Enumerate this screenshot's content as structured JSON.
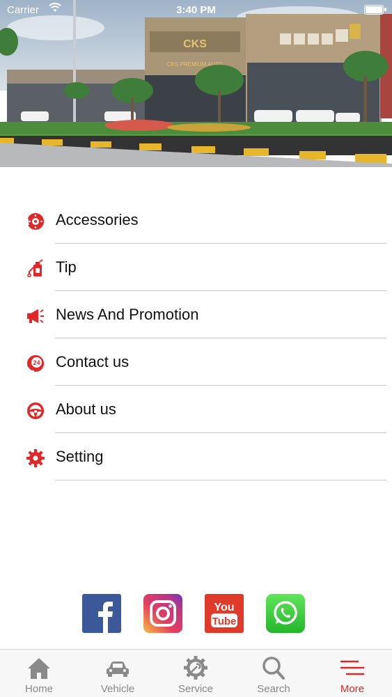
{
  "status_bar": {
    "carrier": "Carrier",
    "time": "3:40 PM"
  },
  "hero": {
    "sign_text": "CKS",
    "sign_subtitle": "CKS PREMIUM AUTO"
  },
  "menu": {
    "items": [
      {
        "label": "Accessories",
        "icon": "brake-disc-icon"
      },
      {
        "label": "Tip",
        "icon": "oil-can-icon"
      },
      {
        "label": "News And Promotion",
        "icon": "megaphone-icon"
      },
      {
        "label": "Contact us",
        "icon": "24h-support-icon"
      },
      {
        "label": "About us",
        "icon": "steering-wheel-icon"
      },
      {
        "label": "Setting",
        "icon": "gear-icon"
      }
    ]
  },
  "social": [
    {
      "name": "Facebook",
      "icon": "facebook-icon",
      "color": "#3b5998"
    },
    {
      "name": "Instagram",
      "icon": "instagram-icon",
      "color": "#c13584"
    },
    {
      "name": "YouTube",
      "icon": "youtube-icon",
      "color": "#e03a2a",
      "text_top": "You",
      "text_bottom": "Tube"
    },
    {
      "name": "WhatsApp",
      "icon": "whatsapp-icon",
      "color": "#34c038"
    }
  ],
  "tabbar": {
    "tabs": [
      {
        "label": "Home",
        "icon": "home-icon"
      },
      {
        "label": "Vehicle",
        "icon": "car-icon"
      },
      {
        "label": "Service",
        "icon": "service-gear-icon"
      },
      {
        "label": "Search",
        "icon": "search-icon"
      },
      {
        "label": "More",
        "icon": "menu-icon",
        "active": true
      }
    ]
  },
  "colors": {
    "accent": "#e02828",
    "inactive": "#8a8a8a",
    "divider": "#c9c9c9"
  }
}
